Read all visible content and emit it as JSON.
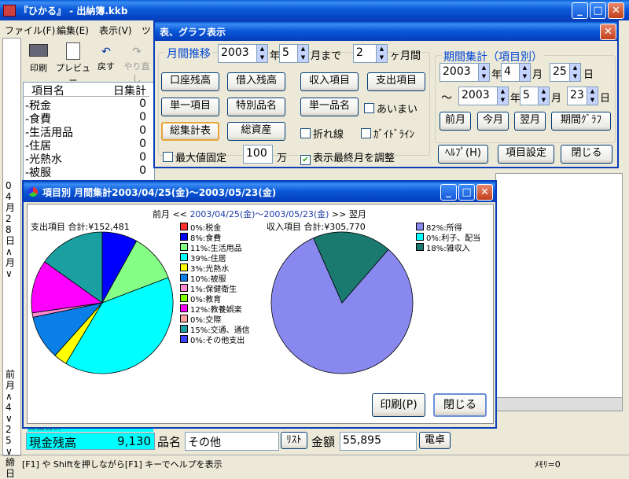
{
  "main": {
    "title": "『ひかる』 - 出納簿.kkb",
    "menu": [
      "ファイル(F)",
      "編集(E)",
      "表示(V)",
      "ツ"
    ],
    "toolbar": [
      "印刷",
      "プレビュー",
      "戻す",
      "やり直し"
    ],
    "list_header": {
      "name": "項目名",
      "amount": "日集計"
    },
    "rows": [
      {
        "name": "-税金",
        "amount": "0"
      },
      {
        "name": "-食費",
        "amount": "0"
      },
      {
        "name": "-生活用品",
        "amount": "0"
      },
      {
        "name": "-住居",
        "amount": "0"
      },
      {
        "name": "-光熱水",
        "amount": "0"
      },
      {
        "name": "-被服",
        "amount": "0"
      }
    ],
    "side_date_top": "04月28日∧月∨",
    "side_date_bottom": "前月∧4∨25∨締日",
    "bottom_partial": "支出合計",
    "cash_label": "現金残高",
    "cash_value": "9,130",
    "item_label": "品名",
    "item_value": "その他",
    "list_btn": "ﾘｽﾄ",
    "amount_label": "金額",
    "amount_value": "55,895",
    "calc_btn": "電卓",
    "status": "[F1] や Shiftを押しながら[F1] キーでヘルプを表示",
    "memory": "ﾒﾓﾘ=0"
  },
  "dialog": {
    "title": "表、グラフ表示",
    "monthly_caption": "月間推移",
    "year": "2003",
    "year_unit": "年",
    "month": "5",
    "month_unit": "月まで",
    "months": "2",
    "months_unit": "ヶ月間",
    "buttons_left": [
      "口座残高",
      "借入残高",
      "収入項目",
      "支出項目",
      "単一項目",
      "特別品名",
      "単一品名",
      "総集計表",
      "総資産"
    ],
    "checks": {
      "fuzzy": "あいまい",
      "polyline": "折れ線",
      "guideline": "ｶﾞｲﾄﾞﾗｲﾝ",
      "max_fixed": "最大値固定",
      "adjust_last": "表示最終月を調整"
    },
    "max_value": "100",
    "max_unit": "万",
    "period_caption": "期間集計（項目別）",
    "from": {
      "y": "2003",
      "y_u": "年",
      "m": "4",
      "m_u": "月",
      "d": "25",
      "d_u": "日"
    },
    "tilde": "～",
    "to": {
      "y": "2003",
      "y_u": "年",
      "m": "5",
      "m_u": "月",
      "d": "23",
      "d_u": "日"
    },
    "period_buttons": [
      "前月",
      "今月",
      "翌月",
      "期間ｸﾞﾗﾌ"
    ],
    "footer_buttons": [
      "ﾍﾙﾌﾟ(H)",
      "項目設定",
      "閉じる"
    ]
  },
  "chart_window": {
    "title": "項目別 月間集計2003/04/25(金)～2003/05/23(金)",
    "nav_prev": "前月 <<",
    "nav_range": "2003/04/25(金)～2003/05/23(金)",
    "nav_next": ">> 翌月",
    "print_btn": "印刷(P)",
    "close_btn": "閉じる",
    "accent": "#1a3aa8"
  },
  "chart_data": [
    {
      "type": "pie",
      "title": "支出項目 合計:¥152,481",
      "labels": [
        "0%:税金",
        "8%:食費",
        "11%:生活用品",
        "39%:住居",
        "3%:光熱水",
        "10%:被服",
        "1%:保健衛生",
        "0%:教育",
        "12%:教養娯楽",
        "0%:交際",
        "15%:交通、通信",
        "0%:その他支出"
      ],
      "values": [
        0,
        8,
        11,
        39,
        3,
        10,
        1,
        0,
        12,
        0,
        15,
        0
      ],
      "colors": [
        "#ff3030",
        "#0000ff",
        "#86ff86",
        "#00ffff",
        "#ffff00",
        "#0b7fe8",
        "#ff8cd2",
        "#80ff00",
        "#ff00ff",
        "#ffa0a0",
        "#1aa0a0",
        "#4040ff"
      ]
    },
    {
      "type": "pie",
      "title": "収入項目 合計:¥305,770",
      "labels": [
        "82%:所得",
        "0%:利子、配当",
        "18%:雑収入"
      ],
      "values": [
        82,
        0,
        18
      ],
      "colors": [
        "#8888ee",
        "#00ffff",
        "#1a7a70"
      ]
    }
  ]
}
